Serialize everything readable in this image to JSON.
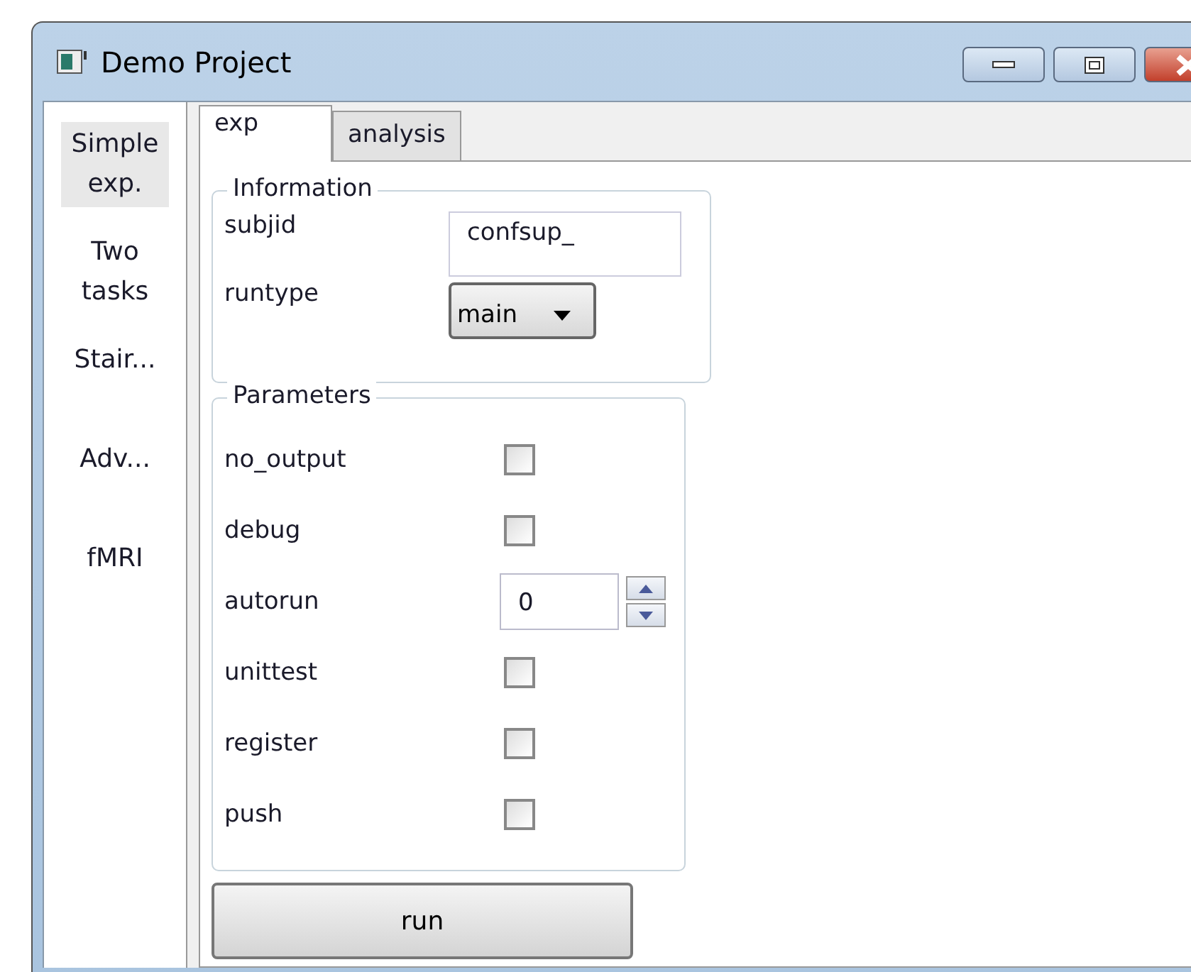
{
  "window": {
    "title": "Demo Project"
  },
  "sidebar": {
    "items": [
      {
        "label": "Simple exp.",
        "selected": true
      },
      {
        "label": "Two tasks",
        "selected": false
      },
      {
        "label": "Stair...",
        "selected": false
      },
      {
        "label": "Adv...",
        "selected": false
      },
      {
        "label": "fMRI",
        "selected": false
      }
    ]
  },
  "tabs": [
    {
      "label": "exp",
      "selected": true
    },
    {
      "label": "analysis",
      "selected": false
    }
  ],
  "information": {
    "title": "Information",
    "fields": [
      {
        "kind": "text",
        "label": "subjid",
        "value": "confsup_"
      },
      {
        "kind": "combo",
        "label": "runtype",
        "value": "main"
      }
    ]
  },
  "parameters": {
    "title": "Parameters",
    "fields": [
      {
        "kind": "checkbox",
        "label": "no_output",
        "checked": false
      },
      {
        "kind": "checkbox",
        "label": "debug",
        "checked": false
      },
      {
        "kind": "spinbox",
        "label": "autorun",
        "value": "0"
      },
      {
        "kind": "checkbox",
        "label": "unittest",
        "checked": false
      },
      {
        "kind": "checkbox",
        "label": "register",
        "checked": false
      },
      {
        "kind": "checkbox",
        "label": "push",
        "checked": false
      }
    ]
  },
  "run_button": "run"
}
